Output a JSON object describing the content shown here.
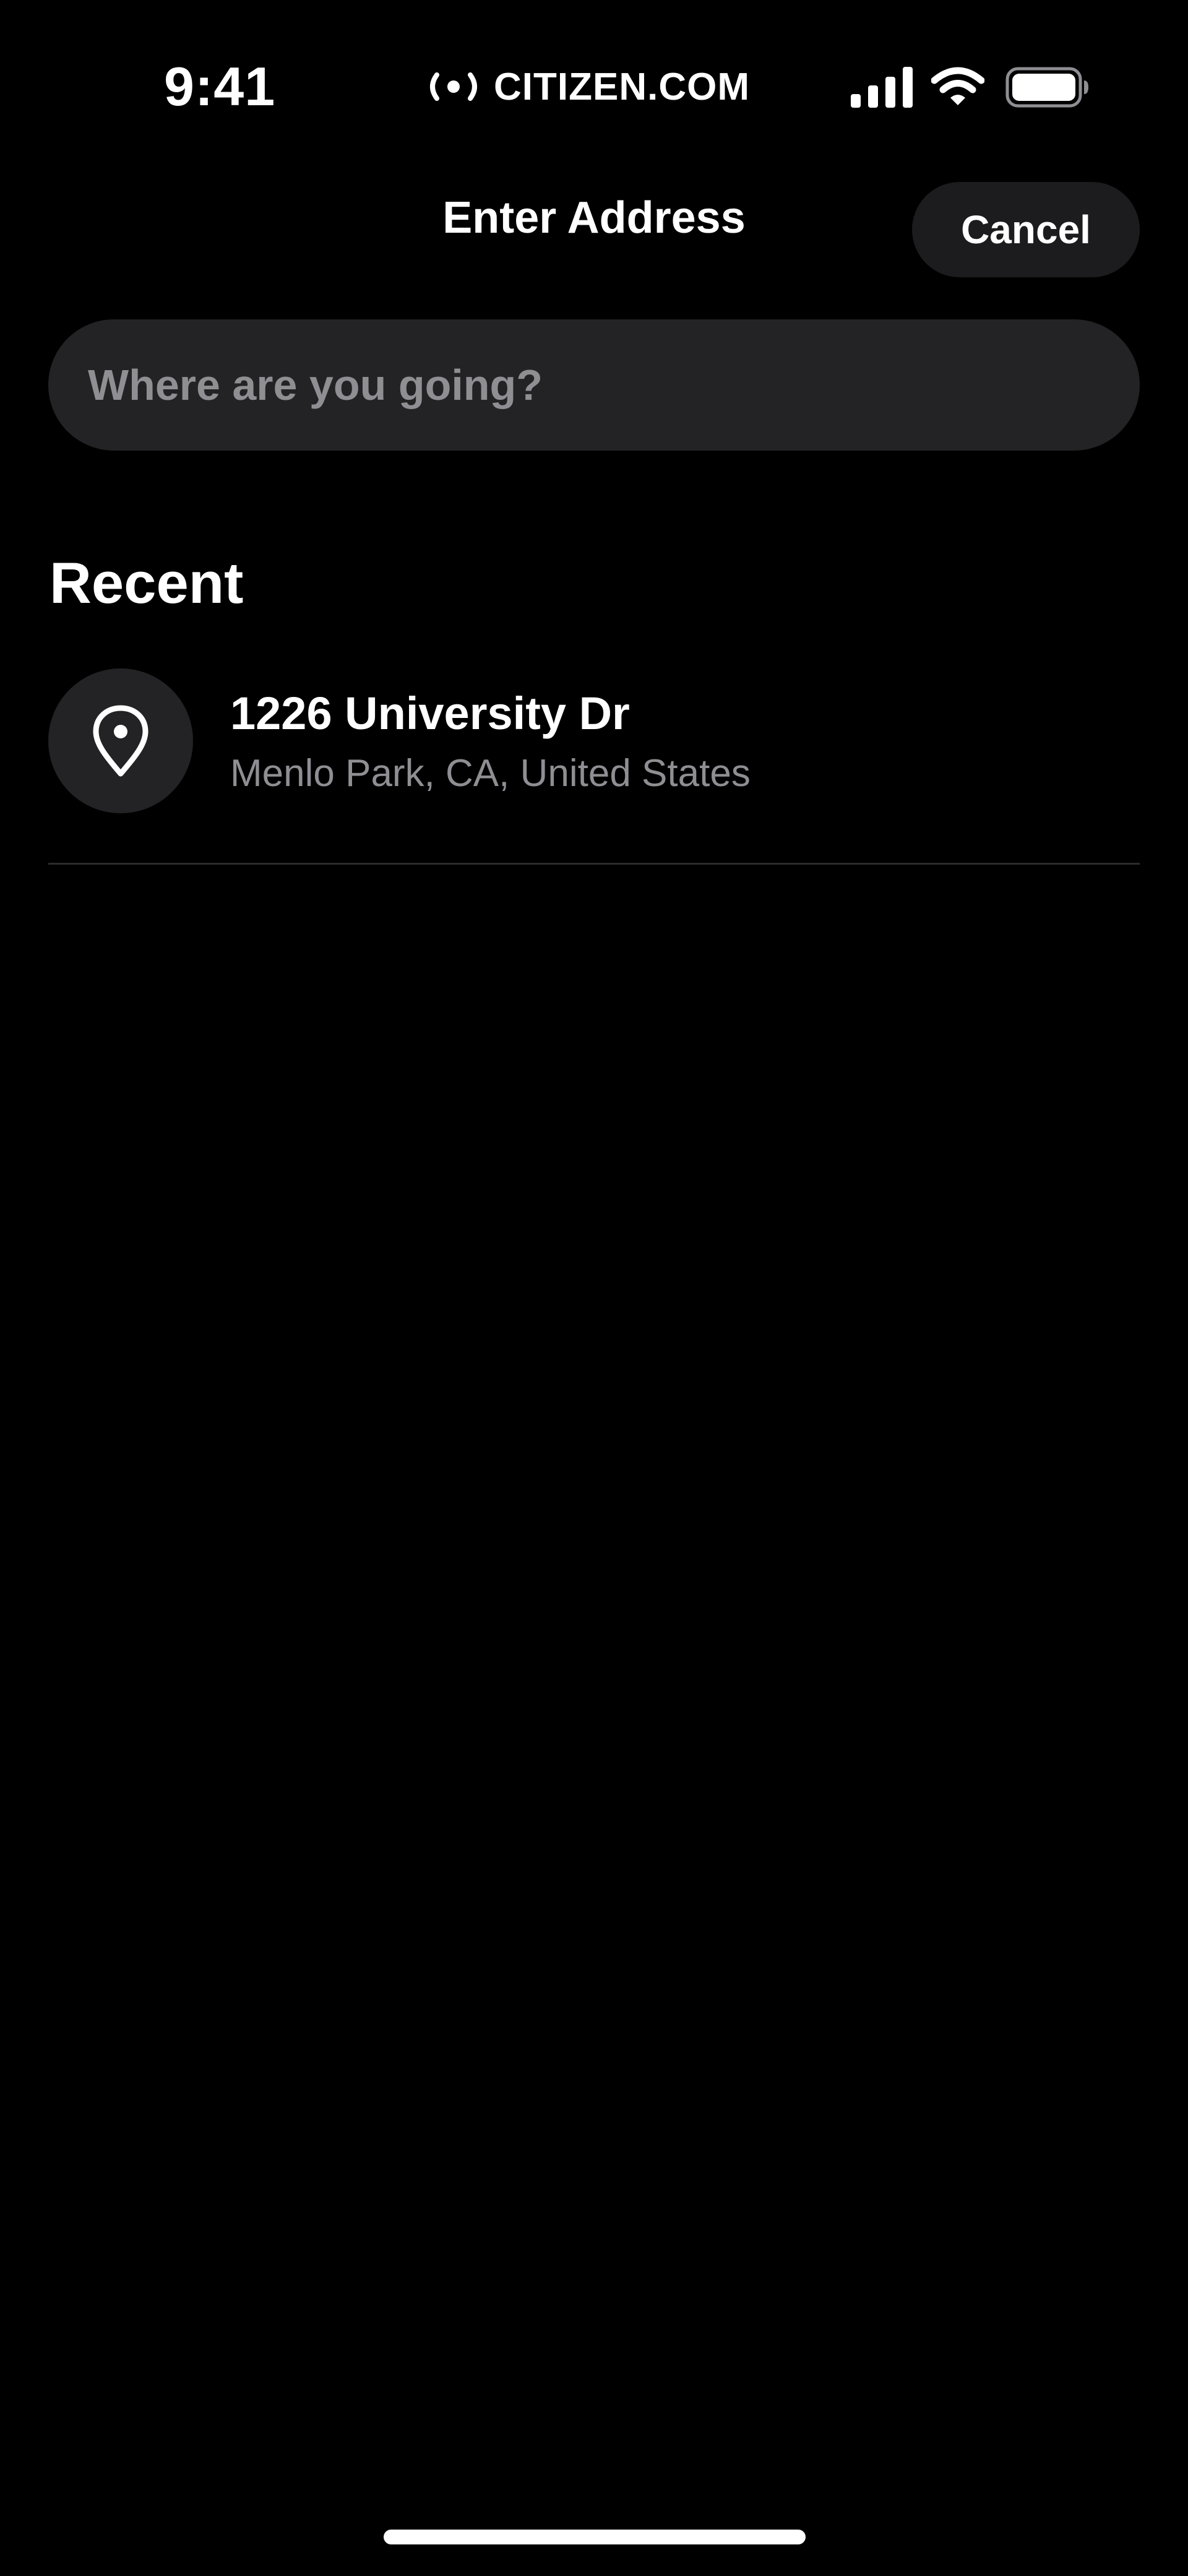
{
  "status_bar": {
    "time": "9:41",
    "brand": "CITIZEN.COM",
    "icons": [
      "signal-icon",
      "wifi-icon",
      "battery-icon"
    ]
  },
  "header": {
    "title": "Enter Address",
    "cancel_label": "Cancel"
  },
  "search": {
    "placeholder": "Where are you going?",
    "value": ""
  },
  "recent": {
    "section_title": "Recent",
    "items": [
      {
        "title": "1226 University Dr",
        "subtitle": "Menlo Park, CA, United States",
        "icon": "map-pin-icon"
      }
    ]
  },
  "colors": {
    "background": "#000000",
    "surface": "#232325",
    "button": "#1c1c1e",
    "secondary_text": "#8e8e93",
    "primary_text": "#ffffff"
  }
}
